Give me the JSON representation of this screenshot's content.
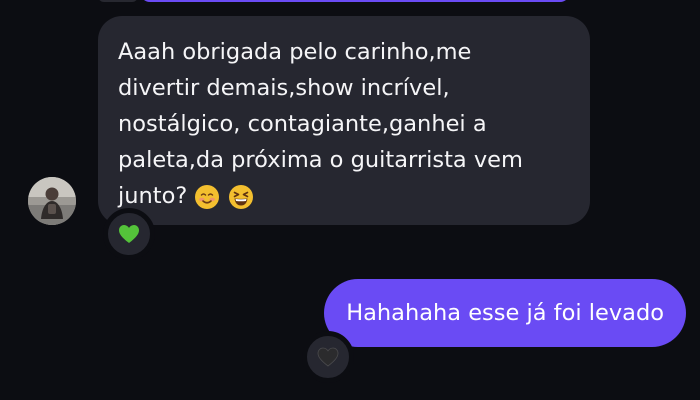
{
  "thread": {
    "messages": [
      {
        "direction": "incoming",
        "lines": [
          "Aaah obrigada pelo carinho,me",
          "divertir demais,show incrível,",
          "nostálgico, contagiante,ganhei a",
          "paleta,da próxima o guitarrista vem",
          "junto?"
        ],
        "emojis": [
          "smiling-face-icon",
          "grinning-squinting-face-icon"
        ],
        "reaction": "green-heart-icon"
      },
      {
        "direction": "outgoing",
        "text": "Hahahaha esse já foi levado",
        "reaction": "black-heart-icon"
      }
    ]
  },
  "colors": {
    "background": "#0c0d12",
    "incoming_bubble": "#262730",
    "outgoing_bubble": "#6a4bf4",
    "text": "#f5f5f7",
    "green_heart": "#54c33a",
    "black_heart": "#2b2b2d"
  }
}
